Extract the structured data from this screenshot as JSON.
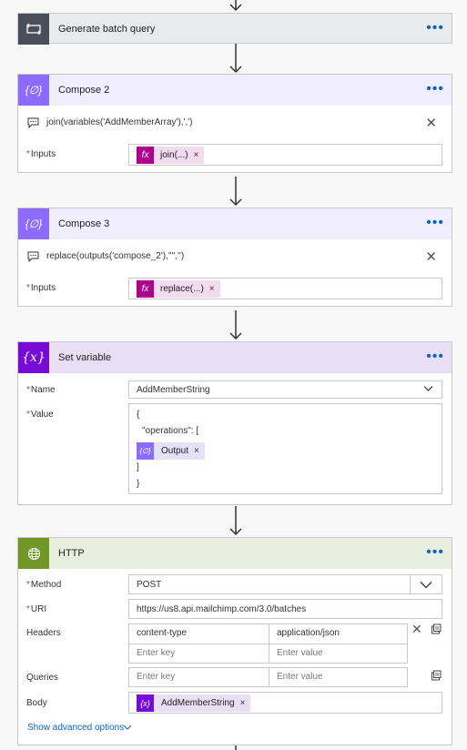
{
  "generate": {
    "title": "Generate batch query"
  },
  "compose2": {
    "title": "Compose 2",
    "comment": "join(variables('AddMemberArray'),',')",
    "inputs_label": "Inputs",
    "token": "join(...)"
  },
  "compose3": {
    "title": "Compose 3",
    "comment": "replace(outputs('compose_2'),'\"','')",
    "inputs_label": "Inputs",
    "token": "replace(...)"
  },
  "setvar": {
    "title": "Set variable",
    "name_label": "Name",
    "name_value": "AddMemberString",
    "value_label": "Value",
    "lines": [
      "{",
      "\"operations\": [",
      "]",
      "}"
    ],
    "token": "Output"
  },
  "http": {
    "title": "HTTP",
    "method_label": "Method",
    "method_value": "POST",
    "uri_label": "URI",
    "uri_value": "https://us8.api.mailchimp.com/3.0/batches",
    "headers_label": "Headers",
    "header_key": "content-type",
    "header_value": "application/json",
    "key_placeholder": "Enter key",
    "value_placeholder": "Enter value",
    "queries_label": "Queries",
    "body_label": "Body",
    "body_token": "AddMemberString",
    "advanced": "Show advanced options"
  },
  "colors": {
    "control": "#484f58",
    "compose": "#8c6cff",
    "compose_bg": "#f0edff",
    "variable": "#770bd6",
    "variable_bg": "#e9dff5",
    "http": "#709727",
    "http_bg": "#e9efdf",
    "expression": "#ad008c",
    "link": "#0a64c8"
  }
}
